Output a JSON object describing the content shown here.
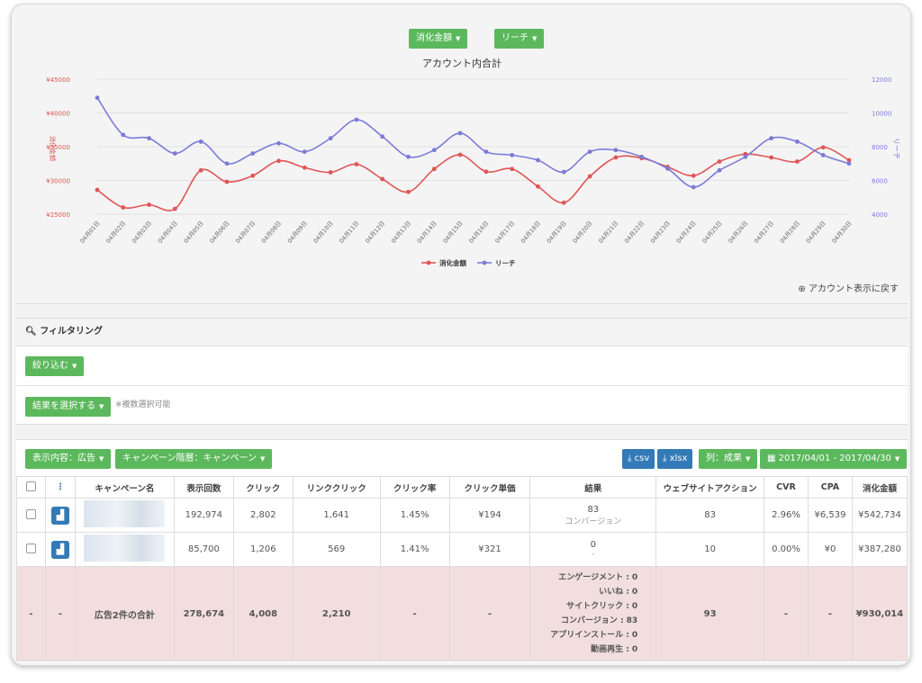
{
  "header": {
    "btn_spend": "消化金額",
    "btn_reach": "リーチ",
    "chart_title": "アカウント内合計",
    "back_link": "アカウント表示に戻す"
  },
  "filter": {
    "title": "フィルタリング",
    "btn_narrow": "絞り込む",
    "btn_select_result": "結果を選択する",
    "note": "※複数選択可能"
  },
  "toolbar": {
    "display_content": "表示内容：広告",
    "campaign_level": "キャンペーン階層：キャンペーン",
    "csv": "csv",
    "xlsx": "xlsx",
    "columns": "列：成果",
    "date_range": "2017/04/01 - 2017/04/30"
  },
  "table": {
    "headers": [
      "",
      "",
      "キャンペーン名",
      "表示回数",
      "クリック",
      "リンククリック",
      "クリック率",
      "クリック単価",
      "結果",
      "ウェブサイトアクション",
      "CVR",
      "CPA",
      "消化金額"
    ],
    "rows": [
      {
        "impressions": "192,974",
        "clicks": "2,802",
        "link_clicks": "1,641",
        "ctr": "1.45%",
        "cpc": "¥194",
        "result": "83",
        "result_sub": "コンバージョン",
        "web_actions": "83",
        "cvr": "2.96%",
        "cpa": "¥6,539",
        "spend": "¥542,734"
      },
      {
        "impressions": "85,700",
        "clicks": "1,206",
        "link_clicks": "569",
        "ctr": "1.41%",
        "cpc": "¥321",
        "result": "0",
        "result_sub": "-",
        "web_actions": "10",
        "cvr": "0.00%",
        "cpa": "¥0",
        "spend": "¥387,280"
      }
    ],
    "total": {
      "c1": "-",
      "c2": "-",
      "label": "広告2件の合計",
      "impressions": "278,674",
      "clicks": "4,008",
      "link_clicks": "2,210",
      "ctr": "-",
      "cpc": "-",
      "web_actions": "93",
      "cvr": "-",
      "cpa": "-",
      "spend": "¥930,014",
      "results": [
        {
          "k": "エンゲージメント",
          "v": "0"
        },
        {
          "k": "いいね",
          "v": "0"
        },
        {
          "k": "サイトクリック",
          "v": "0"
        },
        {
          "k": "コンバージョン",
          "v": "83"
        },
        {
          "k": "アプリインストール",
          "v": "0"
        },
        {
          "k": "動画再生",
          "v": "0"
        }
      ]
    }
  },
  "colors": {
    "spend": "#e05555",
    "reach": "#7b7bd6",
    "green": "#5cb85c",
    "blue": "#337ab7"
  },
  "chart_data": {
    "type": "line",
    "categories": [
      "04月01日",
      "04月02日",
      "04月03日",
      "04月04日",
      "04月05日",
      "04月06日",
      "04月07日",
      "04月08日",
      "04月09日",
      "04月10日",
      "04月11日",
      "04月12日",
      "04月13日",
      "04月14日",
      "04月15日",
      "04月16日",
      "04月17日",
      "04月18日",
      "04月19日",
      "04月20日",
      "04月21日",
      "04月22日",
      "04月23日",
      "04月24日",
      "04月25日",
      "04月26日",
      "04月27日",
      "04月28日",
      "04月29日",
      "04月30日"
    ],
    "series": [
      {
        "name": "消化金額",
        "axis": "left",
        "values": [
          28600,
          26000,
          26400,
          25800,
          31500,
          29800,
          30700,
          32900,
          31900,
          31200,
          32400,
          30200,
          28300,
          31700,
          33800,
          31300,
          31700,
          29100,
          26700,
          30600,
          33400,
          33300,
          32000,
          30700,
          32800,
          33900,
          33400,
          32800,
          34900,
          33000
        ]
      },
      {
        "name": "リーチ",
        "axis": "right",
        "values": [
          10900,
          8700,
          8500,
          7600,
          8300,
          7000,
          7600,
          8200,
          7700,
          8500,
          9600,
          8600,
          7400,
          7800,
          8800,
          7700,
          7500,
          7200,
          6500,
          7700,
          7800,
          7400,
          6700,
          5600,
          6600,
          7400,
          8500,
          8300,
          7500,
          7000
        ]
      }
    ],
    "ylabel_left": "消化金額",
    "ylabel_right": "リーチ",
    "yticks_left": [
      "¥45000",
      "¥40000",
      "¥35000",
      "¥30000",
      "¥25000"
    ],
    "yticks_right": [
      "12000",
      "10000",
      "8000",
      "6000",
      "4000"
    ],
    "ylim_left": [
      25000,
      45000
    ],
    "ylim_right": [
      4000,
      12000
    ],
    "legend": "bottom",
    "grid": true
  }
}
